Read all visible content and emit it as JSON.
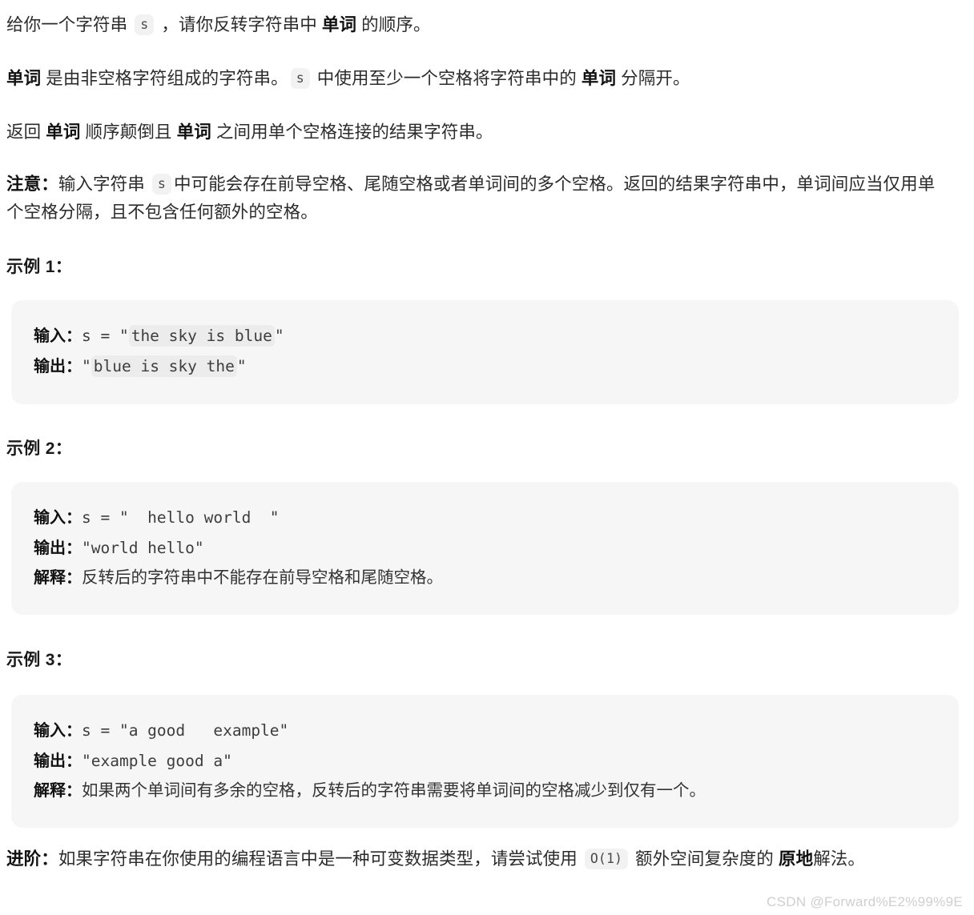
{
  "document": {
    "paragraphs": {
      "p1": {
        "seg1": "给你一个字符串 ",
        "code": "s",
        "seg2": " ，请你反转字符串中 ",
        "bold1": "单词",
        "seg3": " 的顺序。"
      },
      "p2": {
        "bold1": "单词",
        "seg1": " 是由非空格字符组成的字符串。",
        "code": "s",
        "seg2": " 中使用至少一个空格将字符串中的 ",
        "bold2": "单词",
        "seg3": " 分隔开。"
      },
      "p3": {
        "seg1": "返回 ",
        "bold1": "单词",
        "seg2": " 顺序颠倒且 ",
        "bold2": "单词",
        "seg3": " 之间用单个空格连接的结果字符串。"
      },
      "p4": {
        "bold1": "注意：",
        "seg1": "输入字符串 ",
        "code": "s",
        "seg2": "中可能会存在前导空格、尾随空格或者单词间的多个空格。返回的结果字符串中，单词间应当仅用单个空格分隔，且不包含任何额外的空格。"
      },
      "p5": {
        "bold1": "进阶：",
        "seg1": "如果字符串在你使用的编程语言中是一种可变数据类型，请尝试使用 ",
        "code": "O(1)",
        "seg2": " 额外空间复杂度的 ",
        "bold2": "原地",
        "seg3": "解法。"
      }
    },
    "examples": [
      {
        "heading": "示例 1：",
        "input_label": "输入：",
        "input_prefix": "s = \"",
        "input_code": "the sky is blue",
        "input_suffix": "\"",
        "output_label": "输出：",
        "output_prefix": "\"",
        "output_code": "blue is sky the",
        "output_suffix": "\""
      },
      {
        "heading": "示例 2：",
        "input_label": "输入：",
        "input_value": "s = \"  hello world  \"",
        "output_label": "输出：",
        "output_value": "\"world hello\"",
        "explain_label": "解释：",
        "explain_value": "反转后的字符串中不能存在前导空格和尾随空格。"
      },
      {
        "heading": "示例 3：",
        "input_label": "输入：",
        "input_value": "s = \"a good   example\"",
        "output_label": "输出：",
        "output_value": "\"example good a\"",
        "explain_label": "解释：",
        "explain_value": "如果两个单词间有多余的空格，反转后的字符串需要将单词间的空格减少到仅有一个。"
      }
    ],
    "watermark": "CSDN @Forward%E2%99%9E"
  },
  "colors": {
    "page_background": "#ffffff",
    "block_background": "#f6f6f6",
    "chip_background": "#f2f2f2",
    "code_chip_background": "#ececec",
    "body_text": "#2b2b2b",
    "bold_text": "#111111",
    "mono_text": "#3d3d3d",
    "watermark_text": "#cfcfcf"
  }
}
